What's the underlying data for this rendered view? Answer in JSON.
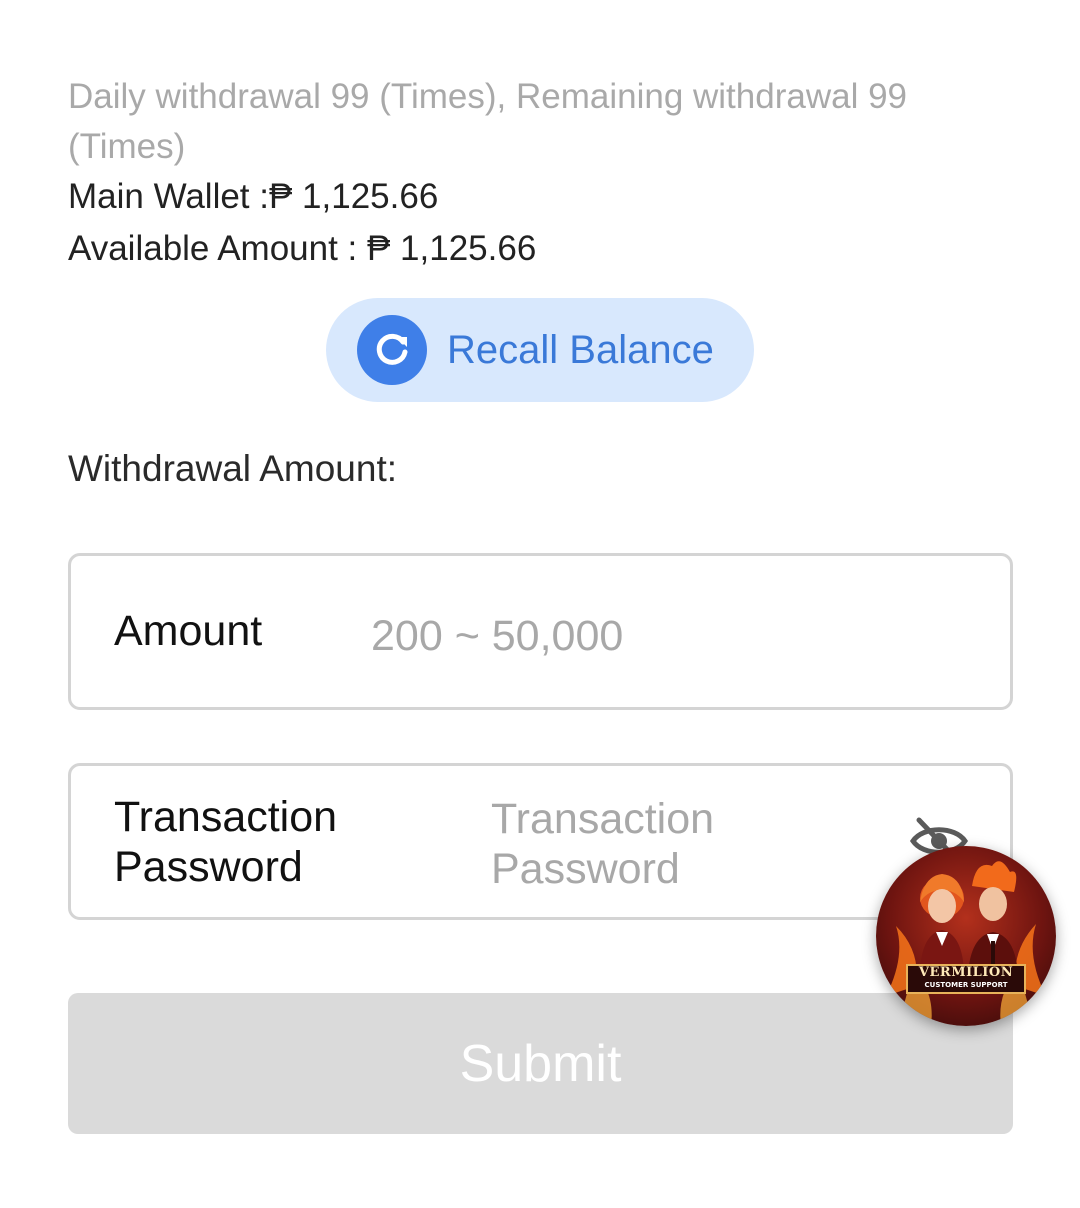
{
  "info": {
    "limits_text": "Daily withdrawal 99 (Times), Remaining withdrawal 99 (Times)",
    "main_wallet_text": "Main Wallet :₱ 1,125.66",
    "available_amount_text": "Available Amount : ₱ 1,125.66"
  },
  "recall": {
    "label": "Recall Balance",
    "icon": "refresh-icon"
  },
  "withdrawal": {
    "section_label": "Withdrawal Amount:",
    "amount_label": "Amount",
    "amount_placeholder": "200 ~ 50,000",
    "amount_value": "",
    "password_label": "Transaction Password",
    "password_placeholder": "Transaction Password",
    "password_value": "",
    "password_visibility_icon": "eye-off-icon"
  },
  "submit": {
    "label": "Submit"
  },
  "support": {
    "brand_name": "VERMILION",
    "brand_sub": "CUSTOMER SUPPORT"
  },
  "colors": {
    "accent_blue": "#3f7fe8",
    "recall_bg": "#d8e8fd",
    "submit_disabled_bg": "#dadada",
    "muted_text": "#a9a9a9"
  }
}
